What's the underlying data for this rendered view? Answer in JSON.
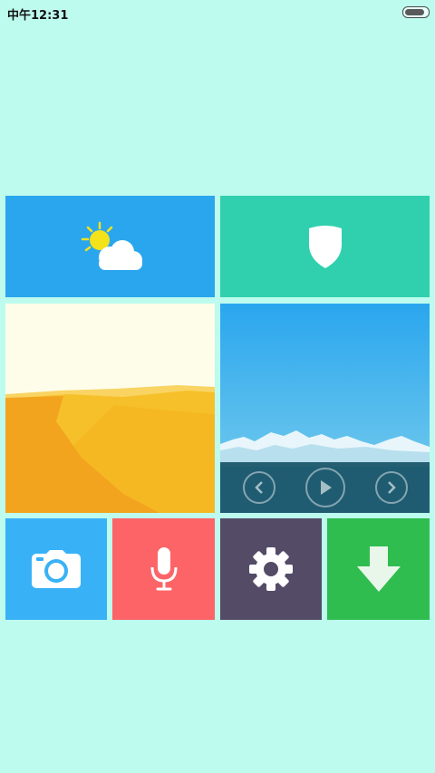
{
  "status_bar": {
    "time": "中午12:31",
    "battery_level": 0.9,
    "battery_icon": "battery-icon"
  },
  "tiles": [
    {
      "name": "weather",
      "icon": "weather-sun-cloud-icon",
      "color": "#2aa6ee"
    },
    {
      "name": "security",
      "icon": "shield-icon",
      "color": "#30d0ae"
    },
    {
      "name": "wallpaper-desert",
      "icon": "desert-landscape"
    },
    {
      "name": "media-player",
      "icon": "mountain-landscape",
      "controls": [
        "previous-icon",
        "play-icon",
        "next-icon"
      ]
    },
    {
      "name": "camera",
      "icon": "camera-icon",
      "color": "#39b1f7"
    },
    {
      "name": "voice",
      "icon": "microphone-icon",
      "color": "#fd6467"
    },
    {
      "name": "settings",
      "icon": "gear-icon",
      "color": "#544c67"
    },
    {
      "name": "download",
      "icon": "download-arrow-icon",
      "color": "#2fbd4f"
    }
  ],
  "colors": {
    "background": "#bdfbee",
    "sky_desert": "#fefde9",
    "sand_light": "#f6c02a",
    "sand_dark": "#f3a41f",
    "sky_blue_top": "#2aa6ee",
    "media_bar": "#185366"
  }
}
